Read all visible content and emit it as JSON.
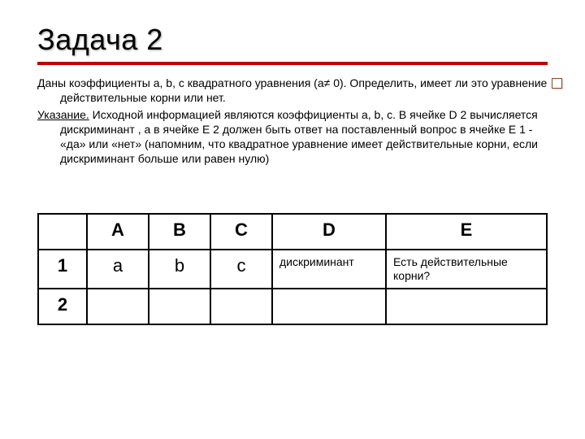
{
  "title": "Задача 2",
  "paragraphs": {
    "p1": "Даны коэффициенты a, b, c квадратного уравнения (a≠ 0). Определить, имеет ли это уравнение действительные корни или нет.",
    "p2_label": "Указание.",
    "p2_rest": " Исходной информацией являются коэффициенты a, b, c. В ячейке D 2 вычисляется дискриминант , а в ячейке E 2 должен быть ответ на поставленный вопрос в ячейке E 1 - «да» или «нет» (напомним, что квадратное уравнение имеет действительные корни, если дискриминант больше или равен нулю)"
  },
  "table": {
    "headers": [
      "A",
      "B",
      "C",
      "D",
      "E"
    ],
    "row_labels": [
      "1",
      "2"
    ],
    "r1": {
      "A": "a",
      "B": "b",
      "C": "c",
      "D": "дискриминант",
      "E": "Есть действительные корни?"
    }
  }
}
